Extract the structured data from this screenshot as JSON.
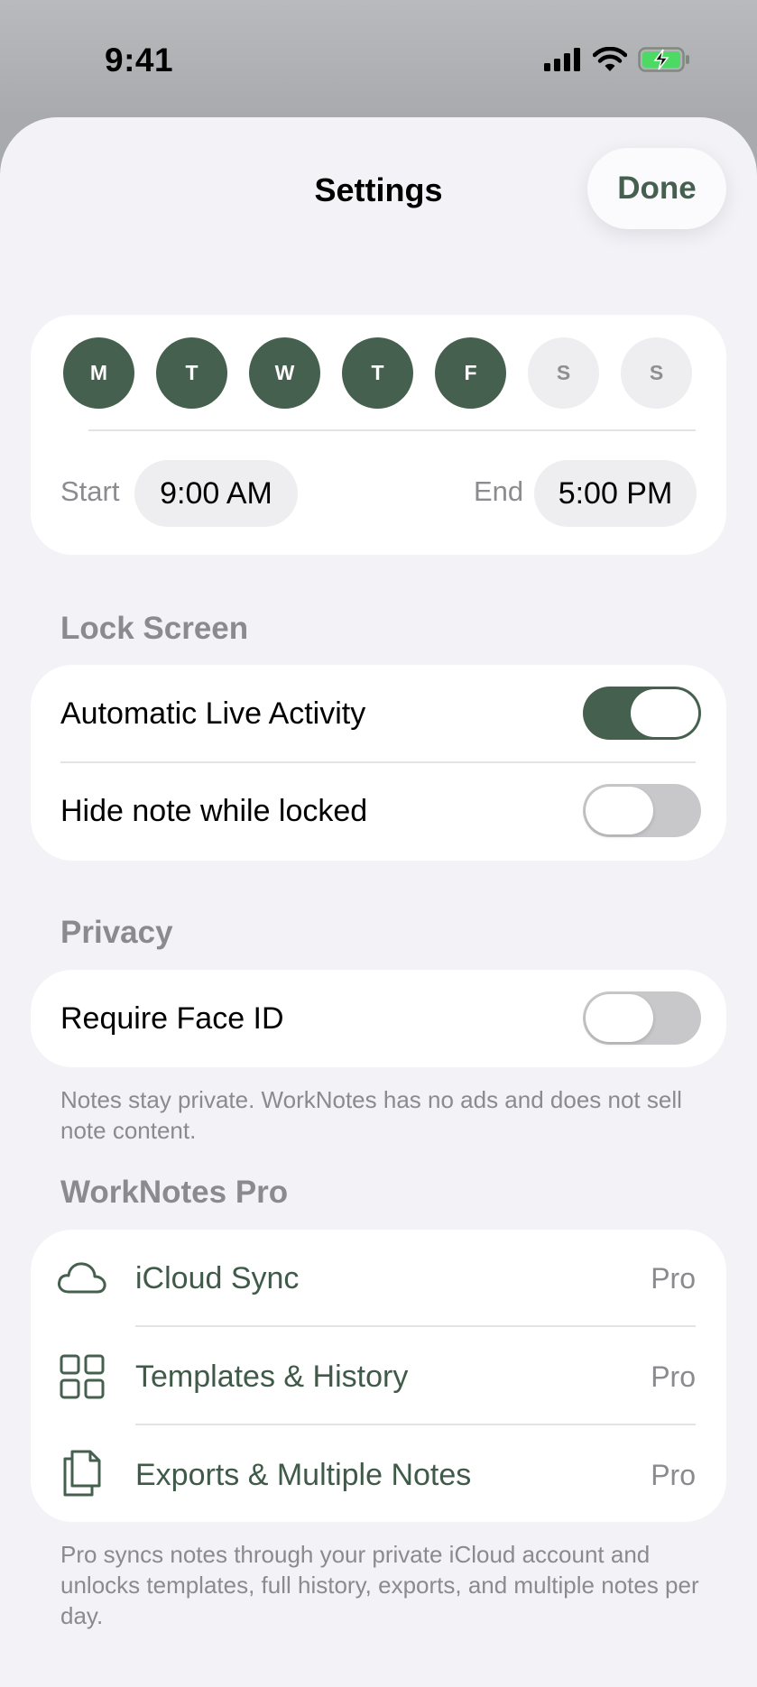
{
  "status_bar": {
    "time": "9:41"
  },
  "nav": {
    "title": "Settings",
    "done_label": "Done"
  },
  "schedule": {
    "days": [
      {
        "letter": "M",
        "selected": true
      },
      {
        "letter": "T",
        "selected": true
      },
      {
        "letter": "W",
        "selected": true
      },
      {
        "letter": "T",
        "selected": true
      },
      {
        "letter": "F",
        "selected": true
      },
      {
        "letter": "S",
        "selected": false
      },
      {
        "letter": "S",
        "selected": false
      }
    ],
    "start_label": "Start",
    "start_time": "9:00 AM",
    "end_label": "End",
    "end_time": "5:00 PM"
  },
  "lock_screen": {
    "header": "Lock Screen",
    "rows": [
      {
        "label": "Automatic Live Activity",
        "on": true
      },
      {
        "label": "Hide note while locked",
        "on": false
      }
    ]
  },
  "privacy": {
    "header": "Privacy",
    "rows": [
      {
        "label": "Require Face ID",
        "on": false
      }
    ],
    "footer": "Notes stay private. WorkNotes has no ads and does not sell note content."
  },
  "pro": {
    "header": "WorkNotes Pro",
    "rows": [
      {
        "icon": "cloud-icon",
        "label": "iCloud Sync",
        "badge": "Pro"
      },
      {
        "icon": "grid-icon",
        "label": "Templates & History",
        "badge": "Pro"
      },
      {
        "icon": "documents-icon",
        "label": "Exports & Multiple Notes",
        "badge": "Pro"
      }
    ],
    "footer": "Pro syncs notes through your private iCloud account and unlocks templates, full history, exports, and multiple notes per day."
  },
  "colors": {
    "accent": "#45604f",
    "sheet_background": "#f2f2f7",
    "card_background": "#ffffff",
    "secondary_text": "#8a8a8f",
    "toggle_off": "#c8c8cb",
    "battery_charging": "#4cd964"
  }
}
